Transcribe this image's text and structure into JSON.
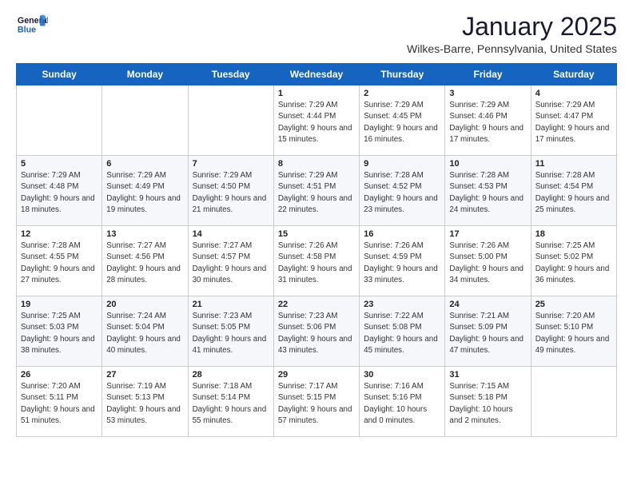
{
  "header": {
    "logo_general": "General",
    "logo_blue": "Blue",
    "month": "January 2025",
    "location": "Wilkes-Barre, Pennsylvania, United States"
  },
  "days_of_week": [
    "Sunday",
    "Monday",
    "Tuesday",
    "Wednesday",
    "Thursday",
    "Friday",
    "Saturday"
  ],
  "weeks": [
    [
      {
        "day": "",
        "sunrise": "",
        "sunset": "",
        "daylight": ""
      },
      {
        "day": "",
        "sunrise": "",
        "sunset": "",
        "daylight": ""
      },
      {
        "day": "",
        "sunrise": "",
        "sunset": "",
        "daylight": ""
      },
      {
        "day": "1",
        "sunrise": "Sunrise: 7:29 AM",
        "sunset": "Sunset: 4:44 PM",
        "daylight": "Daylight: 9 hours and 15 minutes."
      },
      {
        "day": "2",
        "sunrise": "Sunrise: 7:29 AM",
        "sunset": "Sunset: 4:45 PM",
        "daylight": "Daylight: 9 hours and 16 minutes."
      },
      {
        "day": "3",
        "sunrise": "Sunrise: 7:29 AM",
        "sunset": "Sunset: 4:46 PM",
        "daylight": "Daylight: 9 hours and 17 minutes."
      },
      {
        "day": "4",
        "sunrise": "Sunrise: 7:29 AM",
        "sunset": "Sunset: 4:47 PM",
        "daylight": "Daylight: 9 hours and 17 minutes."
      }
    ],
    [
      {
        "day": "5",
        "sunrise": "Sunrise: 7:29 AM",
        "sunset": "Sunset: 4:48 PM",
        "daylight": "Daylight: 9 hours and 18 minutes."
      },
      {
        "day": "6",
        "sunrise": "Sunrise: 7:29 AM",
        "sunset": "Sunset: 4:49 PM",
        "daylight": "Daylight: 9 hours and 19 minutes."
      },
      {
        "day": "7",
        "sunrise": "Sunrise: 7:29 AM",
        "sunset": "Sunset: 4:50 PM",
        "daylight": "Daylight: 9 hours and 21 minutes."
      },
      {
        "day": "8",
        "sunrise": "Sunrise: 7:29 AM",
        "sunset": "Sunset: 4:51 PM",
        "daylight": "Daylight: 9 hours and 22 minutes."
      },
      {
        "day": "9",
        "sunrise": "Sunrise: 7:28 AM",
        "sunset": "Sunset: 4:52 PM",
        "daylight": "Daylight: 9 hours and 23 minutes."
      },
      {
        "day": "10",
        "sunrise": "Sunrise: 7:28 AM",
        "sunset": "Sunset: 4:53 PM",
        "daylight": "Daylight: 9 hours and 24 minutes."
      },
      {
        "day": "11",
        "sunrise": "Sunrise: 7:28 AM",
        "sunset": "Sunset: 4:54 PM",
        "daylight": "Daylight: 9 hours and 25 minutes."
      }
    ],
    [
      {
        "day": "12",
        "sunrise": "Sunrise: 7:28 AM",
        "sunset": "Sunset: 4:55 PM",
        "daylight": "Daylight: 9 hours and 27 minutes."
      },
      {
        "day": "13",
        "sunrise": "Sunrise: 7:27 AM",
        "sunset": "Sunset: 4:56 PM",
        "daylight": "Daylight: 9 hours and 28 minutes."
      },
      {
        "day": "14",
        "sunrise": "Sunrise: 7:27 AM",
        "sunset": "Sunset: 4:57 PM",
        "daylight": "Daylight: 9 hours and 30 minutes."
      },
      {
        "day": "15",
        "sunrise": "Sunrise: 7:26 AM",
        "sunset": "Sunset: 4:58 PM",
        "daylight": "Daylight: 9 hours and 31 minutes."
      },
      {
        "day": "16",
        "sunrise": "Sunrise: 7:26 AM",
        "sunset": "Sunset: 4:59 PM",
        "daylight": "Daylight: 9 hours and 33 minutes."
      },
      {
        "day": "17",
        "sunrise": "Sunrise: 7:26 AM",
        "sunset": "Sunset: 5:00 PM",
        "daylight": "Daylight: 9 hours and 34 minutes."
      },
      {
        "day": "18",
        "sunrise": "Sunrise: 7:25 AM",
        "sunset": "Sunset: 5:02 PM",
        "daylight": "Daylight: 9 hours and 36 minutes."
      }
    ],
    [
      {
        "day": "19",
        "sunrise": "Sunrise: 7:25 AM",
        "sunset": "Sunset: 5:03 PM",
        "daylight": "Daylight: 9 hours and 38 minutes."
      },
      {
        "day": "20",
        "sunrise": "Sunrise: 7:24 AM",
        "sunset": "Sunset: 5:04 PM",
        "daylight": "Daylight: 9 hours and 40 minutes."
      },
      {
        "day": "21",
        "sunrise": "Sunrise: 7:23 AM",
        "sunset": "Sunset: 5:05 PM",
        "daylight": "Daylight: 9 hours and 41 minutes."
      },
      {
        "day": "22",
        "sunrise": "Sunrise: 7:23 AM",
        "sunset": "Sunset: 5:06 PM",
        "daylight": "Daylight: 9 hours and 43 minutes."
      },
      {
        "day": "23",
        "sunrise": "Sunrise: 7:22 AM",
        "sunset": "Sunset: 5:08 PM",
        "daylight": "Daylight: 9 hours and 45 minutes."
      },
      {
        "day": "24",
        "sunrise": "Sunrise: 7:21 AM",
        "sunset": "Sunset: 5:09 PM",
        "daylight": "Daylight: 9 hours and 47 minutes."
      },
      {
        "day": "25",
        "sunrise": "Sunrise: 7:20 AM",
        "sunset": "Sunset: 5:10 PM",
        "daylight": "Daylight: 9 hours and 49 minutes."
      }
    ],
    [
      {
        "day": "26",
        "sunrise": "Sunrise: 7:20 AM",
        "sunset": "Sunset: 5:11 PM",
        "daylight": "Daylight: 9 hours and 51 minutes."
      },
      {
        "day": "27",
        "sunrise": "Sunrise: 7:19 AM",
        "sunset": "Sunset: 5:13 PM",
        "daylight": "Daylight: 9 hours and 53 minutes."
      },
      {
        "day": "28",
        "sunrise": "Sunrise: 7:18 AM",
        "sunset": "Sunset: 5:14 PM",
        "daylight": "Daylight: 9 hours and 55 minutes."
      },
      {
        "day": "29",
        "sunrise": "Sunrise: 7:17 AM",
        "sunset": "Sunset: 5:15 PM",
        "daylight": "Daylight: 9 hours and 57 minutes."
      },
      {
        "day": "30",
        "sunrise": "Sunrise: 7:16 AM",
        "sunset": "Sunset: 5:16 PM",
        "daylight": "Daylight: 10 hours and 0 minutes."
      },
      {
        "day": "31",
        "sunrise": "Sunrise: 7:15 AM",
        "sunset": "Sunset: 5:18 PM",
        "daylight": "Daylight: 10 hours and 2 minutes."
      },
      {
        "day": "",
        "sunrise": "",
        "sunset": "",
        "daylight": ""
      }
    ]
  ]
}
